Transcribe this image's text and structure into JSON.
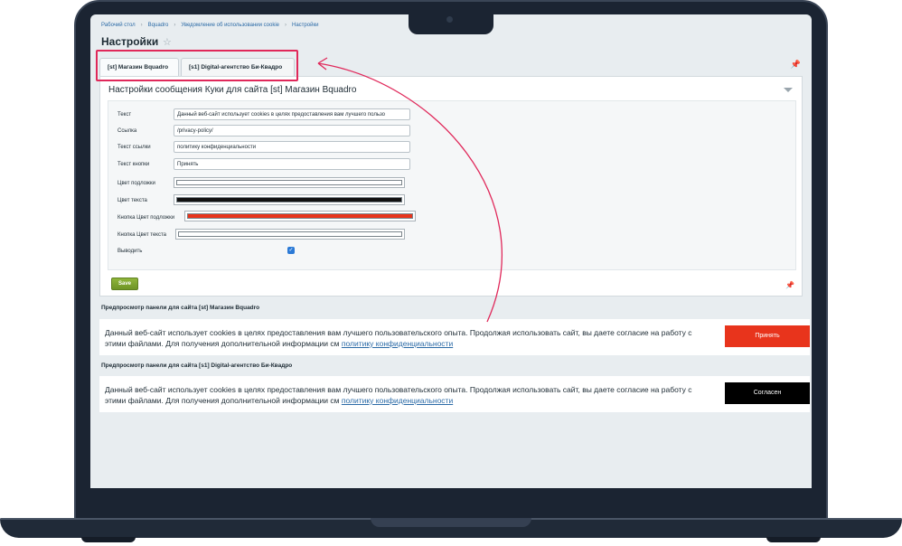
{
  "breadcrumb": [
    "Рабочий стол",
    "Bquadro",
    "Уведомление об использовании cookie",
    "Настройки"
  ],
  "page_title": "Настройки",
  "tabs": [
    {
      "label": "[st] Магазин Bquadro",
      "active": true
    },
    {
      "label": "[s1] Digital-агентство Би-Квадро",
      "active": false
    }
  ],
  "panel": {
    "title": "Настройки сообщения Куки для сайта [st] Магазин Bquadro"
  },
  "form": {
    "text": {
      "label": "Текст",
      "value": "Данный веб-сайт использует cookies в целях предоставления вам лучшего пользо"
    },
    "link": {
      "label": "Ссылка",
      "value": "/privacy-policy/"
    },
    "link_text": {
      "label": "Текст ссылки",
      "value": "политику конфиденциальности"
    },
    "button_text": {
      "label": "Текст кнопки",
      "value": "Принять"
    },
    "bg_color": {
      "label": "Цвет подложки",
      "color": "#ffffff"
    },
    "text_color": {
      "label": "Цвет текста",
      "color": "#111111"
    },
    "button_bg_color": {
      "label": "Кнопка Цвет подложки",
      "color": "#e8341c"
    },
    "button_text_color": {
      "label": "Кнопка Цвет текста",
      "color": "#ffffff"
    },
    "show": {
      "label": "Выводить",
      "checked": true
    }
  },
  "save_label": "Save",
  "preview_st": {
    "heading": "Предпросмотр панели для сайта [st] Магазин Bquadro",
    "text": "Данный веб-сайт использует cookies в целях предоставления вам лучшего пользовательского опыта. Продолжая использовать сайт, вы даете согласие на работу с этими файлами. Для получения дополнительной информации см",
    "link": "политику конфиденциальности",
    "button": "Принять",
    "button_color": "#e8341c"
  },
  "preview_s1": {
    "heading": "Предпросмотр панели для сайта [s1] Digital-агентство Би-Квадро",
    "text": "Данный веб-сайт использует cookies в целях предоставления вам лучшего пользовательского опыта. Продолжая использовать сайт, вы даете согласие на работу с этими файлами. Для получения дополнительной информации см",
    "link": "политику конфиденциальности",
    "button": "Согласен",
    "button_color": "#000000"
  },
  "colors": {
    "highlight": "#e0285a",
    "save": "#7ea22f",
    "link": "#2b6aa6"
  }
}
